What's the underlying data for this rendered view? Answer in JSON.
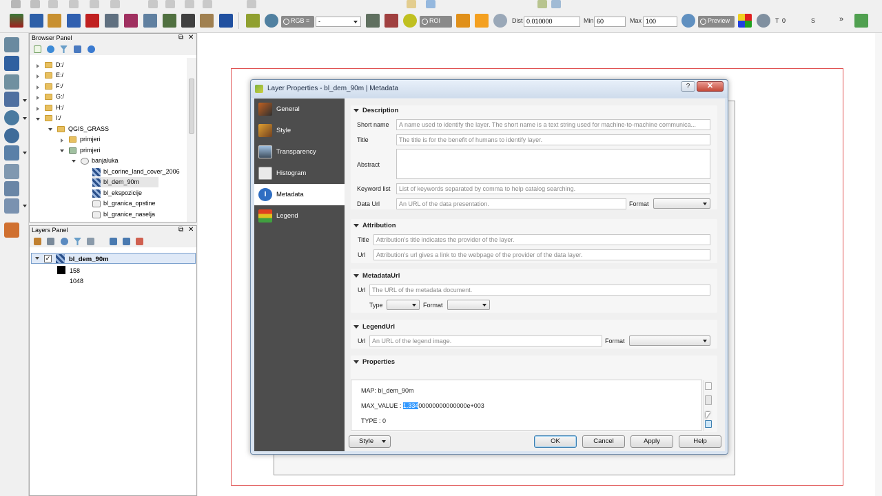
{
  "colors": {
    "map_frame": "#e05050",
    "sidebar": "#4d4d4d",
    "highlight": "#3399ff"
  },
  "toolbar": {
    "rgb_label": "RGB =",
    "rgb_value": "-",
    "roi_label": "ROI",
    "dist_label": "Dist",
    "dist_value": "0.010000",
    "min_label": "Min",
    "min_value": "60",
    "max_label": "Max",
    "max_value": "100",
    "preview_label": "Preview",
    "t_label": "T",
    "t_value": "0",
    "s_label": "S",
    "expand_icon": "double-chevron-right-icon"
  },
  "browser_panel": {
    "title": "Browser Panel",
    "items": [
      {
        "label": "D:/"
      },
      {
        "label": "E:/"
      },
      {
        "label": "F:/"
      },
      {
        "label": "G:/"
      },
      {
        "label": "H:/"
      },
      {
        "label": "I:/"
      },
      {
        "label": "QGIS_GRASS"
      },
      {
        "label": "primjeri"
      },
      {
        "label": "primjeri"
      },
      {
        "label": "banjaluka"
      },
      {
        "label": "bl_corine_land_cover_2006"
      },
      {
        "label": "bl_dem_90m"
      },
      {
        "label": "bl_ekspozicije"
      },
      {
        "label": "bl_granica_opstine"
      },
      {
        "label": "bl_granice_naselja"
      }
    ]
  },
  "layers_panel": {
    "title": "Layers Panel",
    "layer_name": "bl_dem_90m",
    "legend_values": [
      "158",
      "1048"
    ]
  },
  "dialog": {
    "title": "Layer Properties - bl_dem_90m | Metadata",
    "help": "?",
    "close": "✕",
    "sidebar": [
      {
        "label": "General",
        "icon": "tools-icon"
      },
      {
        "label": "Style",
        "icon": "brush-icon"
      },
      {
        "label": "Transparency",
        "icon": "transparency-icon"
      },
      {
        "label": "Histogram",
        "icon": "histogram-icon"
      },
      {
        "label": "Metadata",
        "icon": "info-icon"
      },
      {
        "label": "Legend",
        "icon": "legend-icon"
      }
    ],
    "description": {
      "header": "Description",
      "short_name_label": "Short name",
      "short_name_placeholder": "A name used to identify the layer. The short name is a text string used for machine-to-machine communica...",
      "title_label": "Title",
      "title_placeholder": "The title is for the benefit of humans to identify layer.",
      "abstract_label": "Abstract",
      "keyword_label": "Keyword list",
      "keyword_placeholder": "List of keywords separated by comma to help catalog searching.",
      "dataurl_label": "Data Url",
      "dataurl_placeholder": "An URL of the data presentation.",
      "format_label": "Format"
    },
    "attribution": {
      "header": "Attribution",
      "title_label": "Title",
      "title_placeholder": "Attribution's title indicates the provider of the layer.",
      "url_label": "Url",
      "url_placeholder": "Attribution's url gives a link to the webpage of the provider of the data layer."
    },
    "metadataurl": {
      "header": "MetadataUrl",
      "url_label": "Url",
      "url_placeholder": "The URL of the metadata document.",
      "type_label": "Type",
      "format_label": "Format"
    },
    "legendurl": {
      "header": "LegendUrl",
      "url_label": "Url",
      "url_placeholder": "An URL of the legend image.",
      "format_label": "Format"
    },
    "properties": {
      "header": "Properties",
      "map_line": "MAP: bl_dem_90m",
      "max_prefix": "MAX_VALUE : ",
      "max_highlight": "1.334",
      "max_rest": "00000000000000e+003",
      "type_line": "TYPE : 0"
    },
    "buttons": {
      "style": "Style",
      "ok": "OK",
      "cancel": "Cancel",
      "apply": "Apply",
      "help": "Help"
    }
  }
}
